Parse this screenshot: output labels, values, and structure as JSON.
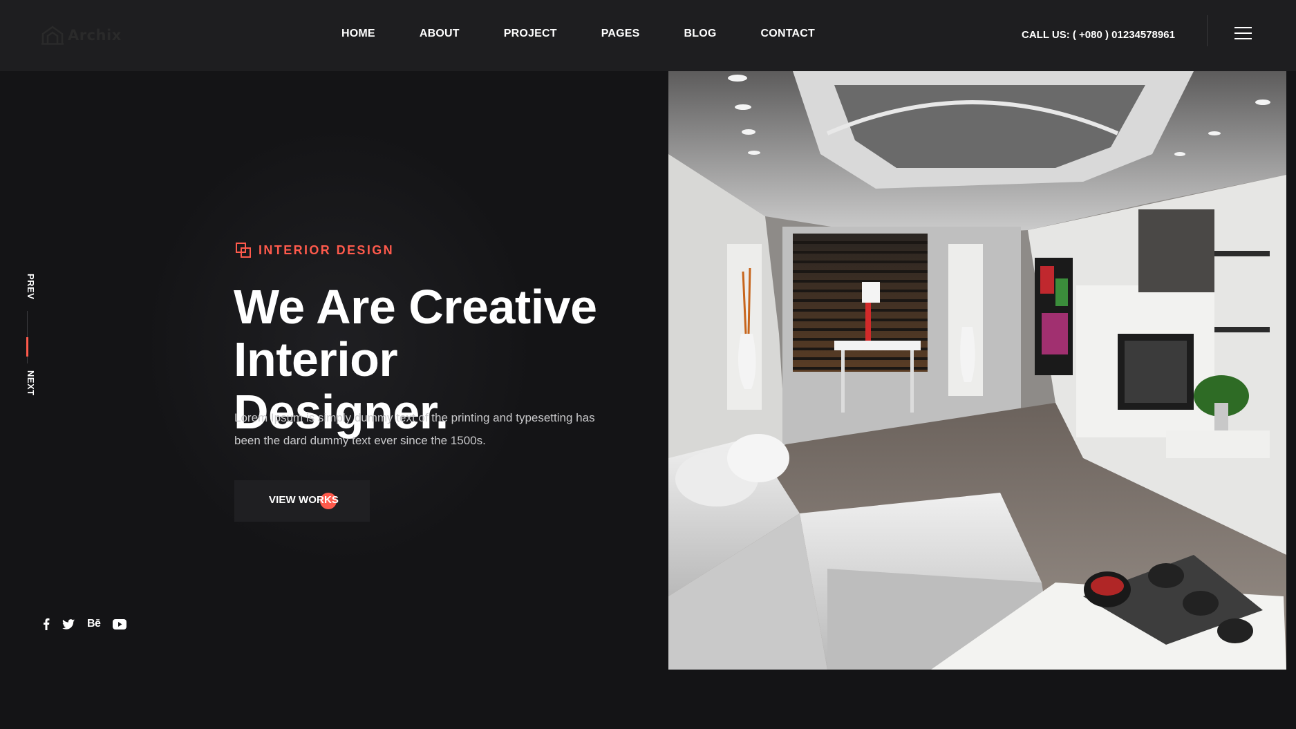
{
  "brand": {
    "name": "Archix",
    "logo_icon": "house-icon"
  },
  "nav": {
    "items": [
      {
        "label": "HOME"
      },
      {
        "label": "ABOUT"
      },
      {
        "label": "PROJECT"
      },
      {
        "label": "PAGES"
      },
      {
        "label": "BLOG"
      },
      {
        "label": "CONTACT"
      }
    ]
  },
  "header": {
    "call": "CALL US: ( +080 ) 01234578961",
    "menu_icon": "hamburger-icon"
  },
  "slider": {
    "prev": "PREV",
    "next": "NEXT"
  },
  "hero": {
    "eyebrow": "INTERIOR DESIGN",
    "title_line1": "We Are Creative",
    "title_line2": "Interior Designer.",
    "description": "Lorem Ipsum is simply dummy text of the printing and typesetting has been the dard dummy text ever since the 1500s.",
    "cta": "VIEW WORKS",
    "image_icon": "interior-room-photo"
  },
  "social": [
    {
      "name": "facebook-icon"
    },
    {
      "name": "twitter-icon"
    },
    {
      "name": "behance-icon",
      "label": "Bē"
    },
    {
      "name": "youtube-icon"
    }
  ],
  "colors": {
    "accent": "#ff5a4c",
    "background": "#141416",
    "header": "#1e1e20"
  }
}
